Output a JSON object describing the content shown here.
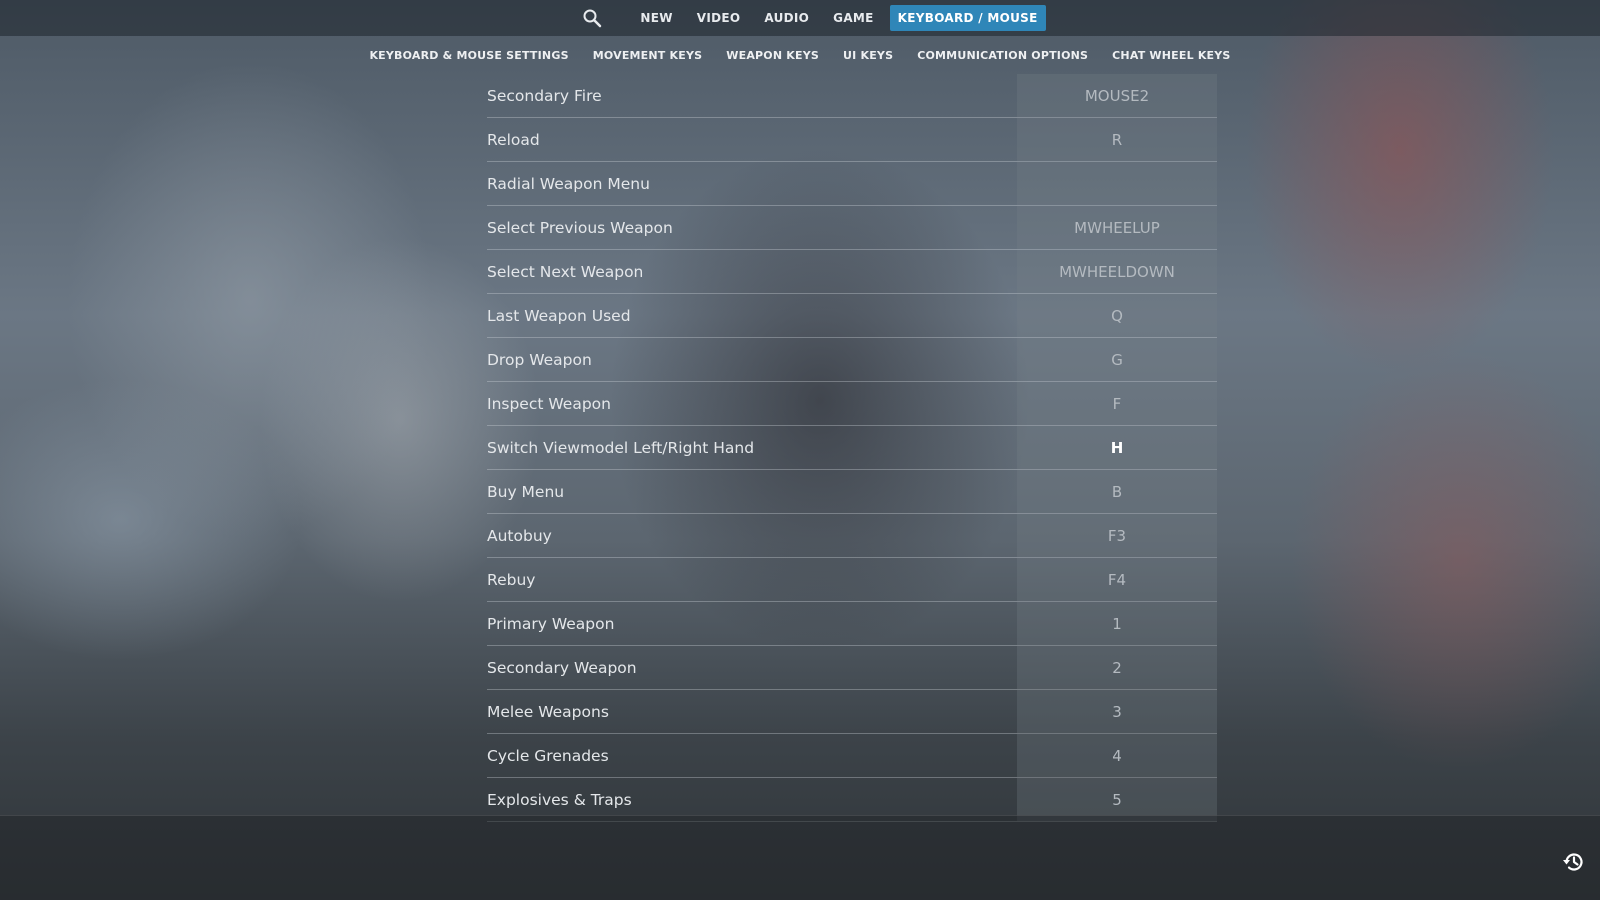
{
  "topnav": {
    "items": [
      {
        "label": "NEW"
      },
      {
        "label": "VIDEO"
      },
      {
        "label": "AUDIO"
      },
      {
        "label": "GAME"
      },
      {
        "label": "KEYBOARD / MOUSE",
        "active": true
      }
    ]
  },
  "subnav": {
    "items": [
      {
        "label": "KEYBOARD & MOUSE SETTINGS"
      },
      {
        "label": "MOVEMENT KEYS"
      },
      {
        "label": "WEAPON KEYS"
      },
      {
        "label": "UI KEYS"
      },
      {
        "label": "COMMUNICATION OPTIONS"
      },
      {
        "label": "CHAT WHEEL KEYS"
      }
    ]
  },
  "bindings": [
    {
      "action": "Secondary Fire",
      "key": "MOUSE2"
    },
    {
      "action": "Reload",
      "key": "R"
    },
    {
      "action": "Radial Weapon Menu",
      "key": ""
    },
    {
      "action": "Select Previous Weapon",
      "key": "MWHEELUP"
    },
    {
      "action": "Select Next Weapon",
      "key": "MWHEELDOWN"
    },
    {
      "action": "Last Weapon Used",
      "key": "Q"
    },
    {
      "action": "Drop Weapon",
      "key": "G"
    },
    {
      "action": "Inspect Weapon",
      "key": "F"
    },
    {
      "action": "Switch Viewmodel Left/Right Hand",
      "key": "H"
    },
    {
      "action": "Buy Menu",
      "key": "B"
    },
    {
      "action": "Autobuy",
      "key": "F3"
    },
    {
      "action": "Rebuy",
      "key": "F4"
    },
    {
      "action": "Primary Weapon",
      "key": "1"
    },
    {
      "action": "Secondary Weapon",
      "key": "2"
    },
    {
      "action": "Melee Weapons",
      "key": "3"
    },
    {
      "action": "Cycle Grenades",
      "key": "4"
    },
    {
      "action": "Explosives & Traps",
      "key": "5"
    }
  ],
  "icons": {
    "search": "search-icon",
    "history": "history-icon"
  },
  "colors": {
    "accent": "#2f86b8"
  }
}
